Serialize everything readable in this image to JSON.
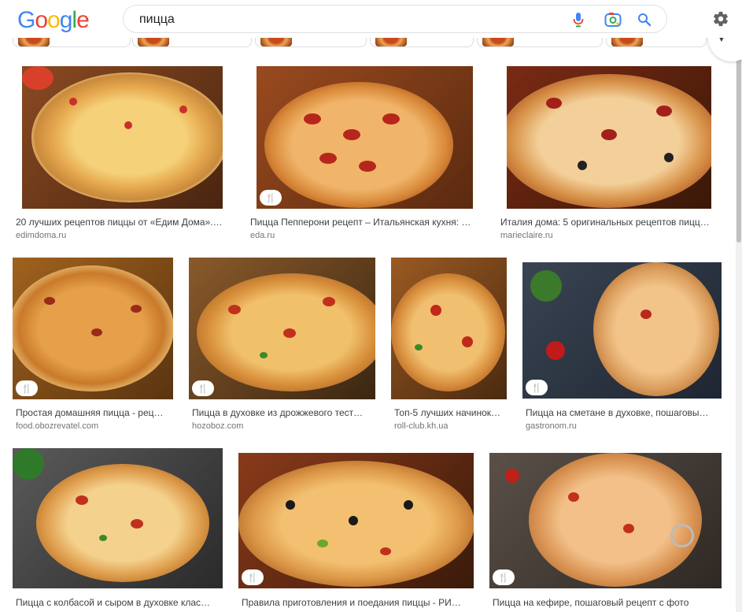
{
  "header": {
    "logo_letters": [
      {
        "ch": "G",
        "color": "#4285F4"
      },
      {
        "ch": "o",
        "color": "#EA4335"
      },
      {
        "ch": "o",
        "color": "#FBBC05"
      },
      {
        "ch": "g",
        "color": "#4285F4"
      },
      {
        "ch": "l",
        "color": "#34A853"
      },
      {
        "ch": "e",
        "color": "#EA4335"
      }
    ],
    "search_value": "пицца",
    "icons": [
      "microphone-icon",
      "google-lens-icon",
      "search-icon",
      "settings-gear-icon"
    ]
  },
  "colors": {
    "accent_blue": "#4285F4",
    "title_text": "#3c4043",
    "site_text": "#70757a"
  },
  "results": [
    {
      "title": "20 лучших рецептов пиццы от «Едим Дома».…",
      "site": "edimdoma.ru",
      "recipe_badge": false
    },
    {
      "title": "Пицца Пепперони рецепт – Итальянская кухня: …",
      "site": "eda.ru",
      "recipe_badge": true
    },
    {
      "title": "Италия дома: 5 оригинальных рецептов пицц…",
      "site": "marieclaire.ru",
      "recipe_badge": false
    },
    {
      "title": "Простая домашняя пицца - рец…",
      "site": "food.obozrevatel.com",
      "recipe_badge": true
    },
    {
      "title": "Пицца в духовке из дрожжевого тест…",
      "site": "hozoboz.com",
      "recipe_badge": true
    },
    {
      "title": "Топ-5 лучших начинок…",
      "site": "roll-club.kh.ua",
      "recipe_badge": false
    },
    {
      "title": "Пицца на сметане в духовке, пошаговы…",
      "site": "gastronom.ru",
      "recipe_badge": true
    },
    {
      "title": "Пицца с колбасой и сыром в духовке клас…",
      "site": "",
      "recipe_badge": false
    },
    {
      "title": "Правила приготовления и поедания пиццы - РИ…",
      "site": "",
      "recipe_badge": true
    },
    {
      "title": "Пицца на кефире, пошаговый рецепт с фото",
      "site": "",
      "recipe_badge": true
    }
  ]
}
